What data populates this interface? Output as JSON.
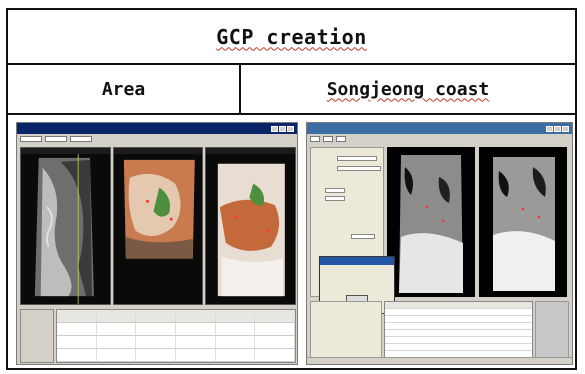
{
  "table": {
    "title": "GCP creation",
    "area_label": "Area",
    "area_value": "Songjeong coast"
  },
  "screenshots": [
    {
      "description_icon": "gcp-manager-window"
    },
    {
      "description_icon": "gcp-geometry-correction-window"
    }
  ]
}
